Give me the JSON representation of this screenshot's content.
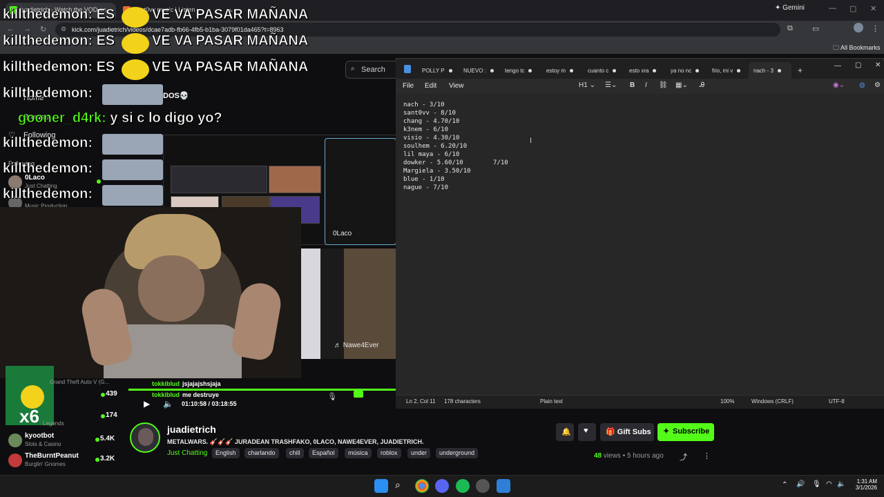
{
  "browser": {
    "tabs": [
      {
        "label": "juadietrich - Watch the VOD on",
        "color": "#53fc18"
      },
      {
        "label": "sant0vv music | Listen",
        "color": "#e86b2d"
      }
    ],
    "gemini_label": "Gemini",
    "url": "kick.com/juadietrich/videos/dcae7adb-fb66-4fb5-b1ba-3079f01da465?t=8963",
    "all_bookmarks": "All Bookmarks"
  },
  "kick": {
    "search_placeholder": "Search",
    "nav": {
      "home": "Home",
      "browse": "Browse",
      "following": "Following",
      "following_section": "Following"
    },
    "sidebar_users": [
      {
        "name": "0Laco",
        "category": "Just Chatting",
        "count": ""
      },
      {
        "name": "",
        "category": "Music Production",
        "count": ""
      },
      {
        "name": "",
        "category": "Grand Theft Auto V (G...",
        "count": "439"
      },
      {
        "name": "",
        "category": "Legends",
        "count": "174"
      },
      {
        "name": "kyootbot",
        "category": "Slots & Casino",
        "count": "5.4K"
      },
      {
        "name": "TheBurntPeanut",
        "category": "Burglin' Gnomes",
        "count": "3.2K"
      }
    ],
    "overlay_chat": [
      {
        "user": "killthedemon:",
        "msg": "ES",
        "tail": "VE VA PASAR MAÑANA"
      },
      {
        "user": "killthedemon:",
        "msg": "ES",
        "tail": "VE VA PASAR MAÑANA"
      },
      {
        "user": "killthedemon:",
        "msg": "ES",
        "tail": "VE VA PASAR MAÑANA"
      },
      {
        "user": "killthedemon:",
        "msg": "",
        "tail": "DOS💀"
      },
      {
        "user": "gooner_d4rk:",
        "msg": "y si c lo digo yo?",
        "tail": ""
      },
      {
        "user": "killthedemon:",
        "msg": "",
        "tail": ""
      },
      {
        "user": "killthedemon:",
        "msg": "",
        "tail": ""
      },
      {
        "user": "killthedemon:",
        "msg": "",
        "tail": ""
      }
    ],
    "screenshare_labels": {
      "olaco": "0Laco",
      "nawe": "Nawe4Ever"
    },
    "player_chat": [
      {
        "user": "tokkiblud",
        "msg": "jsjajajshsjaja"
      },
      {
        "user": "tokkiblud",
        "msg": "me destruye"
      }
    ],
    "timecode": "01:10:58 / 03:18:55",
    "streamer": {
      "name": "juadietrich",
      "title": "METALWARS. 🎸🎸🎸 JURADEAN TRASHFAKO, 0LACO, NAWE4EVER, JUADIETRICH.",
      "category": "Just Chatting",
      "tags": [
        "English",
        "charlando",
        "chill",
        "Español",
        "música",
        "roblox",
        "under",
        "underground"
      ]
    },
    "buttons": {
      "gift_subs": "Gift Subs",
      "subscribe": "Subscribe"
    },
    "views_count": "48",
    "views_suffix": "views • 5 hours ago"
  },
  "notepad": {
    "tabs": [
      "POLLY P",
      "NUEVO :",
      "tengo tc",
      "estoy m",
      "cuanto c",
      "esto xra",
      "ya no nc",
      "frio, mi v",
      "nach - 3"
    ],
    "menu": {
      "file": "File",
      "edit": "Edit",
      "view": "View"
    },
    "heading_tool": "H1",
    "lines": [
      "nach - 3/10",
      "sant0vv - 8/10",
      "chang - 4.70/10",
      "k3nem - 6/10",
      "visio - 4.30/10",
      "soulhem - 6.20/10",
      "lil maya - 6/10",
      "dowker - 5.60/10        7/10",
      "Margiela - 3.50/10",
      "blue - 1/10",
      "nague - 7/10"
    ],
    "status": {
      "position": "Ln 2, Col 11",
      "chars": "178 characters",
      "format": "Plain text",
      "zoom": "100%",
      "eol": "Windows (CRLF)",
      "encoding": "UTF-8"
    }
  },
  "taskbar": {
    "time": "1:31 AM",
    "date": "3/1/2026"
  }
}
